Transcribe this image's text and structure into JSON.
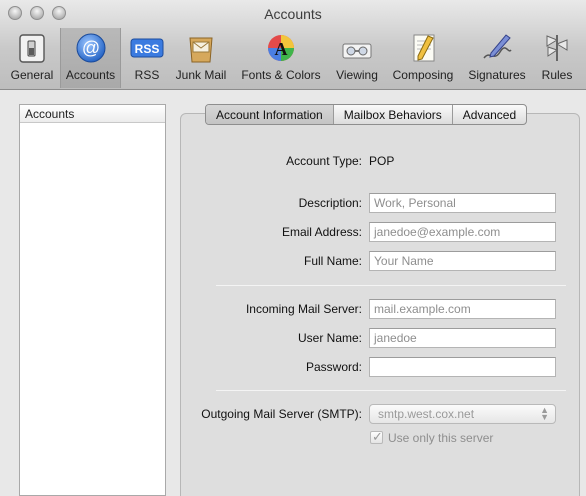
{
  "window": {
    "title": "Accounts"
  },
  "toolbar": {
    "items": [
      {
        "label": "General",
        "icon": "switch-icon"
      },
      {
        "label": "Accounts",
        "icon": "at-sign-icon"
      },
      {
        "label": "RSS",
        "icon": "rss-icon"
      },
      {
        "label": "Junk Mail",
        "icon": "junk-mail-icon"
      },
      {
        "label": "Fonts & Colors",
        "icon": "fonts-colors-icon"
      },
      {
        "label": "Viewing",
        "icon": "viewing-icon"
      },
      {
        "label": "Composing",
        "icon": "composing-icon"
      },
      {
        "label": "Signatures",
        "icon": "signatures-icon"
      },
      {
        "label": "Rules",
        "icon": "rules-icon"
      }
    ],
    "rss_glyph": "RSS",
    "at_glyph": "@",
    "fonts_glyph": "A"
  },
  "sidebar": {
    "header": "Accounts"
  },
  "tabs": [
    {
      "label": "Account Information"
    },
    {
      "label": "Mailbox Behaviors"
    },
    {
      "label": "Advanced"
    }
  ],
  "form": {
    "account_type_label": "Account Type:",
    "account_type_value": "POP",
    "description_label": "Description:",
    "description_placeholder": "Work, Personal",
    "email_label": "Email Address:",
    "email_placeholder": "janedoe@example.com",
    "fullname_label": "Full Name:",
    "fullname_placeholder": "Your Name",
    "incoming_label": "Incoming Mail Server:",
    "incoming_placeholder": "mail.example.com",
    "username_label": "User Name:",
    "username_placeholder": "janedoe",
    "password_label": "Password:",
    "password_value": "",
    "smtp_label": "Outgoing Mail Server (SMTP):",
    "smtp_value": "smtp.west.cox.net",
    "only_server_label": "Use only this server"
  }
}
